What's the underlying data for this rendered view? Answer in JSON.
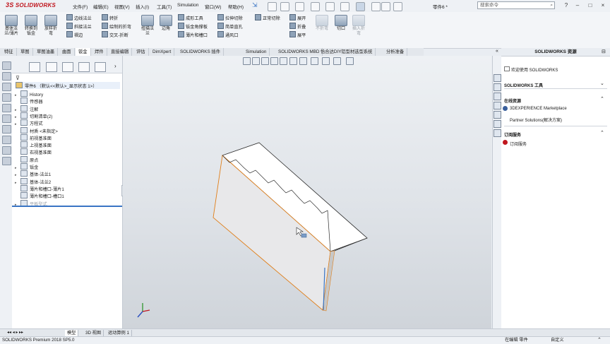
{
  "app": {
    "logo_ds": "3S",
    "logo_text": "SOLIDWORKS"
  },
  "menu": [
    "文件(F)",
    "编辑(E)",
    "视图(V)",
    "插入(I)",
    "工具(T)",
    "Simulation",
    "窗口(W)",
    "帮助(H)"
  ],
  "document_title": "零件6 *",
  "search": {
    "placeholder": "搜索命令"
  },
  "window_buttons": [
    "?",
    "–",
    "□",
    "×"
  ],
  "command_big": [
    {
      "label": "基体法\n兰/薄片"
    },
    {
      "label": "转换到\n钣金"
    },
    {
      "label": "放样折\n弯"
    }
  ],
  "command_col1": [
    "边线法兰",
    "斜接法兰",
    "褶边"
  ],
  "command_col2": [
    "转折",
    "绘制的折弯",
    "交叉-折断"
  ],
  "command_big2": [
    {
      "label": "扭描法\n兰"
    },
    {
      "label": "边角"
    }
  ],
  "command_col3": [
    "成形工具",
    "钣金角撑板",
    "薄片和槽口"
  ],
  "command_col4": [
    "拉伸切除",
    "简单直孔",
    "通风口"
  ],
  "command_col5": [
    "正常切除"
  ],
  "command_col6": [
    "展开",
    "折叠",
    "展平"
  ],
  "command_big3": [
    {
      "label": "不折弯",
      "disabled": true
    },
    {
      "label": "切口"
    },
    {
      "label": "插入折\n弯",
      "disabled": true
    }
  ],
  "tabs": [
    "特征",
    "草图",
    "草图油墨",
    "曲面",
    "钣金",
    "焊件",
    "直接编辑",
    "评估",
    "DimXpert",
    "SOLIDWORKS 插件",
    "Simulation",
    "SOLIDWORKS MBD",
    "恰合达DIY铝型材选型系统",
    "分析准备"
  ],
  "active_tab": "钣金",
  "tree": {
    "root": "零件6 （默认<<默认>_显示状态 1>）",
    "items": [
      {
        "label": "History",
        "arrow": "▸"
      },
      {
        "label": "传感器",
        "arrow": ""
      },
      {
        "label": "注解",
        "arrow": "▸"
      },
      {
        "label": "切割清单(2)",
        "arrow": "▸"
      },
      {
        "label": "方程式",
        "arrow": "▸"
      },
      {
        "label": "材质 <未指定>",
        "arrow": ""
      },
      {
        "label": "前视基准面",
        "arrow": ""
      },
      {
        "label": "上视基准面",
        "arrow": ""
      },
      {
        "label": "右视基准面",
        "arrow": ""
      },
      {
        "label": "原点",
        "arrow": ""
      },
      {
        "label": "钣金",
        "arrow": "▸"
      },
      {
        "label": "基体-法兰1",
        "arrow": "▸"
      },
      {
        "label": "基体-法兰2",
        "arrow": "▸"
      },
      {
        "label": "薄片和槽口-薄片1",
        "arrow": ""
      },
      {
        "label": "薄片和槽口-槽口1",
        "arrow": ""
      },
      {
        "label": "平板型式",
        "arrow": "▸",
        "disabled": true
      }
    ]
  },
  "task_pane": {
    "title": "SOLIDWORKS 资源",
    "welcome": "欢迎使用 SOLIDWORKS",
    "tools_header": "SOLIDWORKS 工具",
    "online_header": "在线资源",
    "online_items": [
      "3DEXPERIENCE Marketplace",
      "Partner Solutions(解决方案)"
    ],
    "subscription_header": "订阅服务",
    "subscription_items": [
      "订阅服务"
    ]
  },
  "bottom_tabs": [
    "模型",
    "3D 视图",
    "运动算例 1"
  ],
  "active_bottom_tab": "模型",
  "status": {
    "left": "SOLIDWORKS Premium 2018 SP5.0",
    "mode": "在编辑 零件",
    "units": "自定义"
  },
  "colors": {
    "accent": "#3a75c4",
    "brand": "#c0161e",
    "edge": "#e07f1a"
  }
}
